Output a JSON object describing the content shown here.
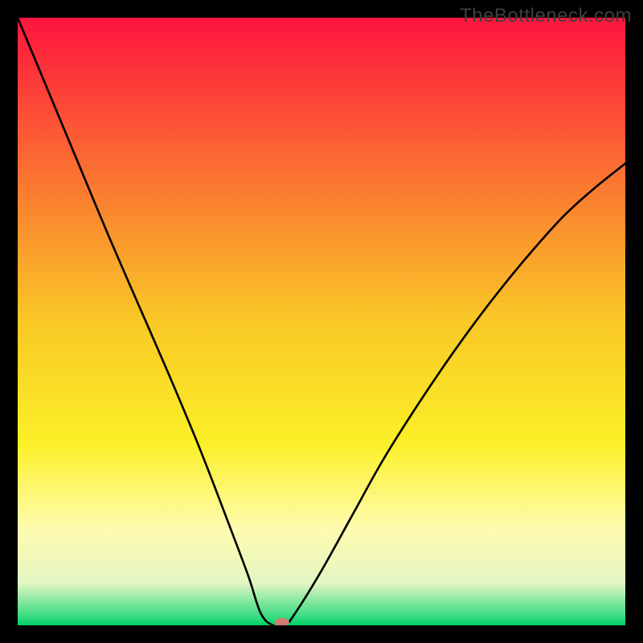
{
  "watermark": "TheBottleneck.com",
  "chart_data": {
    "type": "line",
    "title": "",
    "xlabel": "",
    "ylabel": "",
    "xlim": [
      0,
      100
    ],
    "ylim": [
      0,
      100
    ],
    "grid": false,
    "legend": false,
    "background_gradient": {
      "stops": [
        {
          "offset": 0.0,
          "color": "#fe143e"
        },
        {
          "offset": 0.25,
          "color": "#fb6f32"
        },
        {
          "offset": 0.5,
          "color": "#f9c826"
        },
        {
          "offset": 0.7,
          "color": "#fbf027"
        },
        {
          "offset": 0.84,
          "color": "#fefcae"
        },
        {
          "offset": 0.93,
          "color": "#e4f6c3"
        },
        {
          "offset": 0.99,
          "color": "#29da7c"
        },
        {
          "offset": 1.0,
          "color": "#01cf5e"
        }
      ]
    },
    "curve": {
      "description": "V-shaped bottleneck curve with minimum near x≈42",
      "x": [
        0,
        5,
        10,
        15,
        20,
        25,
        30,
        35,
        38,
        40,
        42,
        44,
        46,
        50,
        55,
        60,
        65,
        70,
        75,
        80,
        85,
        90,
        95,
        100
      ],
      "y": [
        100,
        88,
        76,
        64,
        52.5,
        41,
        29,
        16,
        8,
        2,
        0,
        0,
        2.5,
        9,
        18,
        27,
        35,
        42.5,
        49.5,
        56,
        62,
        67.5,
        72,
        76
      ]
    },
    "marker": {
      "x": 43.5,
      "y": 0.5,
      "color": "#d17a6f",
      "rx": 1.2,
      "ry": 0.7
    }
  }
}
